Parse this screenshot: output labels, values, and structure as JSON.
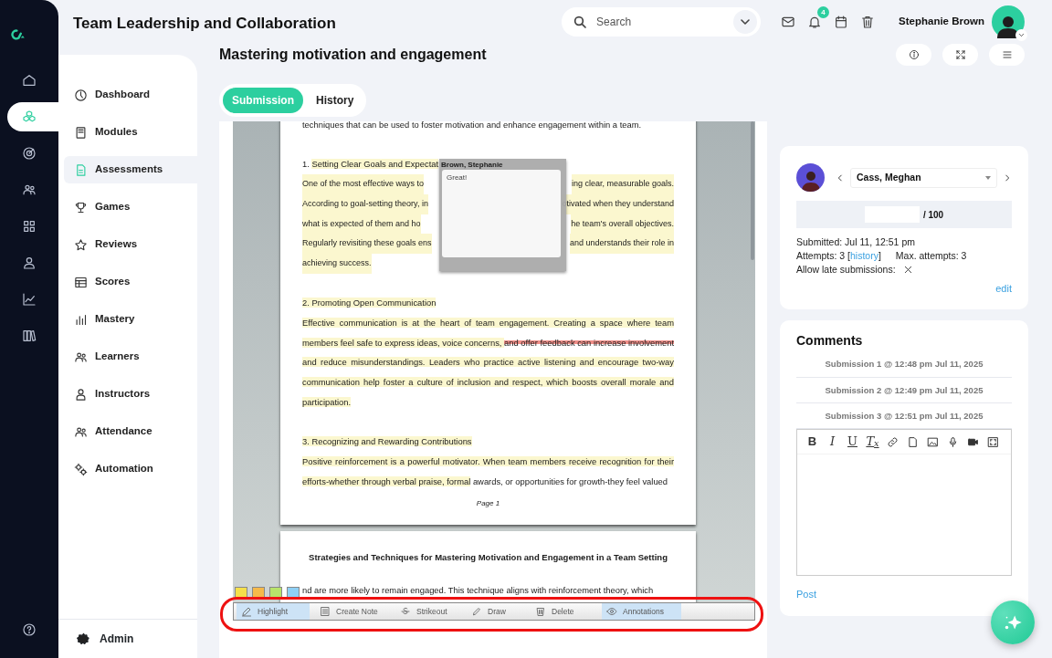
{
  "app": {
    "title": "Team Leadership and Collaboration"
  },
  "search": {
    "placeholder": "Search"
  },
  "notifications": {
    "count": "4"
  },
  "user": {
    "name": "Stephanie Brown"
  },
  "rail": [
    {
      "selected": false
    },
    {
      "selected": true
    },
    {
      "selected": false
    },
    {
      "selected": false
    },
    {
      "selected": false
    },
    {
      "selected": false
    },
    {
      "selected": false
    },
    {
      "selected": false
    }
  ],
  "sidebar": {
    "items": [
      {
        "label": "Dashboard",
        "selected": false
      },
      {
        "label": "Modules",
        "selected": false
      },
      {
        "label": "Assessments",
        "selected": true
      },
      {
        "label": "Games",
        "selected": false
      },
      {
        "label": "Reviews",
        "selected": false
      },
      {
        "label": "Scores",
        "selected": false
      },
      {
        "label": "Mastery",
        "selected": false
      },
      {
        "label": "Learners",
        "selected": false
      },
      {
        "label": "Instructors",
        "selected": false
      },
      {
        "label": "Attendance",
        "selected": false
      },
      {
        "label": "Automation",
        "selected": false
      }
    ],
    "footer": "Admin"
  },
  "page": {
    "title": "Mastering motivation and engagement"
  },
  "tabs": [
    {
      "label": "Submission",
      "selected": true
    },
    {
      "label": "History",
      "selected": false
    }
  ],
  "document": {
    "lead": "techniques that can be used to foster motivation and enhance engagement within a team.",
    "sections": [
      {
        "heading": [
          {
            "kind": "plain",
            "text": "1. "
          },
          {
            "kind": "highlight",
            "text": "Setting Clear Goals and Expectat"
          }
        ],
        "lines": [
          [
            {
              "kind": "highlight",
              "text": "One of the most effective ways to"
            },
            {
              "kind": "highlight",
              "text": "ing clear, measurable goals."
            }
          ],
          [
            {
              "kind": "highlight",
              "text": "According to goal-setting theory, in"
            },
            {
              "kind": "highlight",
              "text": "otivated when they understand"
            }
          ],
          [
            {
              "kind": "highlight",
              "text": "what is expected of them and ho"
            },
            {
              "kind": "highlight",
              "text": "he team's overall objectives."
            }
          ],
          [
            {
              "kind": "highlight",
              "text": "Regularly revisiting these goals ens"
            },
            {
              "kind": "highlight",
              "text": "and understands their role in"
            }
          ],
          [
            {
              "kind": "highlight",
              "text": "achieving success."
            }
          ]
        ]
      },
      {
        "heading": [
          {
            "kind": "highlight",
            "text": "2. Promoting Open Communication"
          }
        ],
        "body": [
          {
            "kind": "highlight",
            "text": "Effective communication is at the heart of team engagement. Creating a space where team members feel safe to express ideas, voice concerns, "
          },
          {
            "kind": "strikeout",
            "text": "and offer feedback can increase involvement"
          },
          {
            "kind": "highlight",
            "text": " and reduce misunderstandings. Leaders who practice active listening and encourage two-way communication help foster a culture of inclusion and respect, which boosts overall morale and participation."
          }
        ]
      },
      {
        "heading": [
          {
            "kind": "highlight",
            "text": "3. Recognizing and Rewarding Contributions"
          }
        ],
        "body": [
          {
            "kind": "highlight",
            "text": "Positive reinforcement is a powerful motivator. When team members receive recognition for their efforts-whether through verbal praise, formal"
          },
          {
            "kind": "plain",
            "text": " awards, or opportunities for growth-they feel valued"
          }
        ]
      }
    ],
    "page_label": "Page 1",
    "page2_title": "Strategies and Techniques for Mastering Motivation and Engagement in a Team Setting",
    "page2_line": "nd are more likely to remain engaged. This technique aligns with reinforcement theory, which"
  },
  "annotation": {
    "author": "Brown, Stephanie",
    "text": "Great!"
  },
  "swatches": [
    {
      "color": "#f5e04a"
    },
    {
      "color": "#f5b94a"
    },
    {
      "color": "#b8e36a"
    },
    {
      "color": "#8fd0f5"
    }
  ],
  "tools": [
    {
      "label": "Highlight",
      "selected": true
    },
    {
      "label": "Create Note",
      "selected": false
    },
    {
      "label": "Strikeout",
      "selected": false
    },
    {
      "label": "Draw",
      "selected": false
    },
    {
      "label": "Delete",
      "selected": false
    },
    {
      "label": "Annotations",
      "selected": true
    }
  ],
  "grading": {
    "student": "Cass, Meghan",
    "max": "/ 100",
    "submitted": "Submitted: Jul 11, 12:51 pm",
    "attempts": "Attempts: 3 [",
    "history_link": "history",
    "attempts_end": "]",
    "max_attempts": "Max. attempts: 3",
    "late": "Allow late submissions:",
    "late_allowed": false,
    "edit": "edit"
  },
  "comments": {
    "title": "Comments",
    "submissions": [
      "Submission 1 @ 12:48 pm Jul 11, 2025",
      "Submission 2 @ 12:49 pm Jul 11, 2025",
      "Submission 3 @ 12:51 pm Jul 11, 2025"
    ],
    "format_buttons": [
      "B",
      "I",
      "U",
      "T$_{x}$"
    ],
    "post": "Post"
  }
}
